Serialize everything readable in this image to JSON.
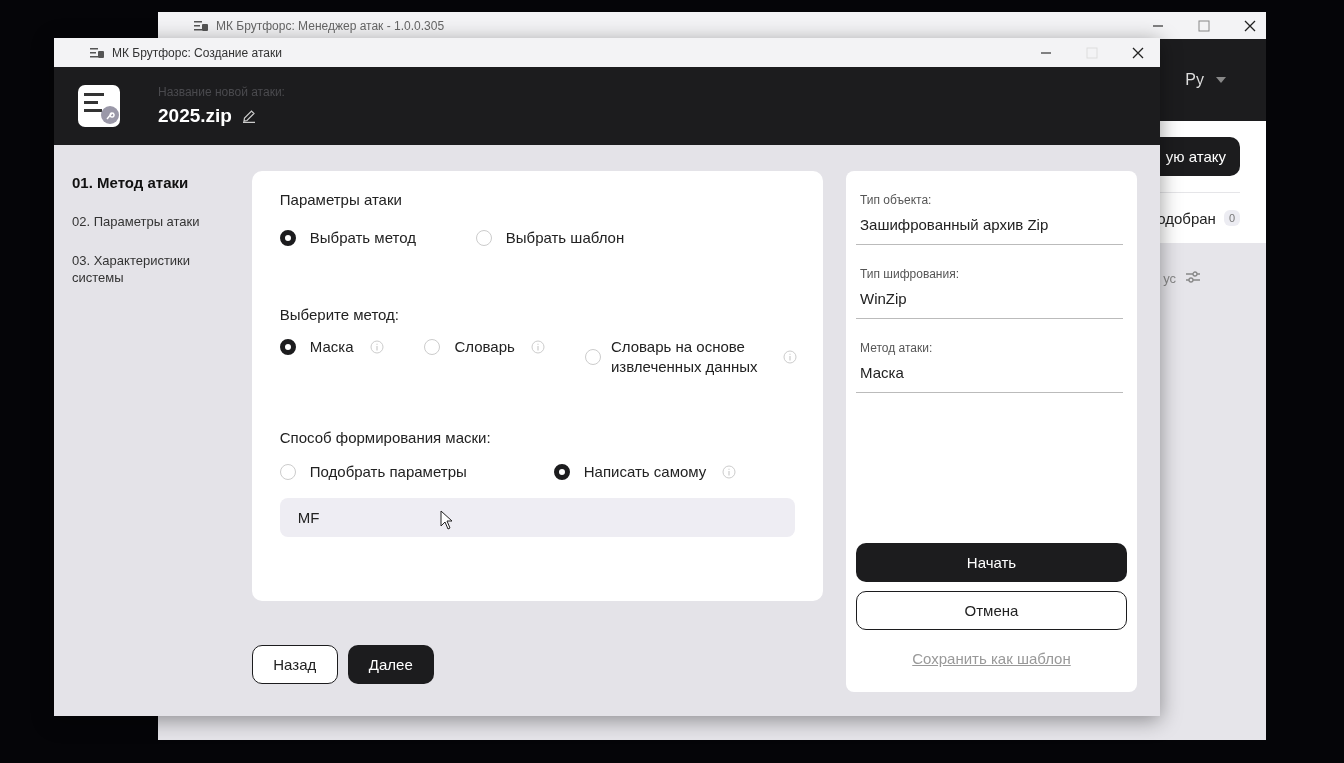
{
  "back_window": {
    "title": "МК Брутфорс: Менеджер атак - 1.0.0.305",
    "language": "Ру",
    "action_button": "ую атаку",
    "filter_tab": {
      "label": "одобран",
      "count": "0"
    },
    "column_label": "ус"
  },
  "window": {
    "title": "МК Брутфорс: Создание атаки"
  },
  "header": {
    "name_label": "Название новой атаки:",
    "name": "2025.zip"
  },
  "steps": [
    {
      "label": "01. Метод атаки",
      "selected": true
    },
    {
      "label": "02. Параметры атаки",
      "selected": false
    },
    {
      "label": "03. Характеристики системы",
      "selected": false
    }
  ],
  "form": {
    "title": "Параметры атаки",
    "mode_options": [
      {
        "label": "Выбрать метод",
        "selected": true
      },
      {
        "label": "Выбрать шаблон",
        "selected": false
      }
    ],
    "method_label": "Выберите метод:",
    "methods": [
      {
        "label": "Маска",
        "selected": true,
        "info": true
      },
      {
        "label": "Словарь",
        "selected": false,
        "info": true
      },
      {
        "label": "Словарь на основе извлеченных данных",
        "selected": false,
        "info": true
      }
    ],
    "mask_label": "Способ формирования маски:",
    "mask_modes": [
      {
        "label": "Подобрать параметры",
        "selected": false,
        "info": false
      },
      {
        "label": "Написать самому",
        "selected": true,
        "info": true
      }
    ],
    "mask_value": "MF"
  },
  "buttons": [
    {
      "label": "Назад",
      "kind": "secondary"
    },
    {
      "label": "Далее",
      "kind": "primary"
    }
  ],
  "summary": {
    "fields": [
      {
        "label": "Тип объекта:",
        "value": "Зашифрованный архив Zip"
      },
      {
        "label": "Тип шифрования:",
        "value": "WinZip"
      },
      {
        "label": "Метод атаки:",
        "value": "Маска"
      }
    ],
    "actions": [
      {
        "label": "Начать",
        "kind": "primary"
      },
      {
        "label": "Отмена",
        "kind": "secondary"
      },
      {
        "label": "Сохранить как шаблон",
        "kind": "link"
      }
    ]
  }
}
